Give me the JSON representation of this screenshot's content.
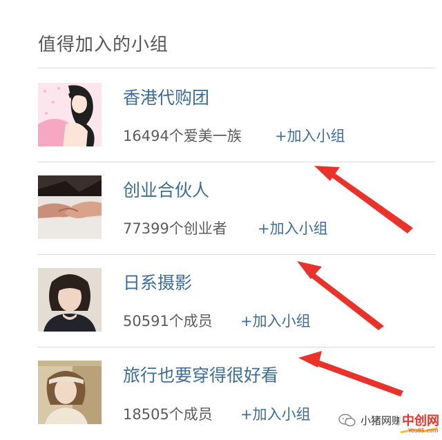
{
  "section": {
    "title": "值得加入的小组"
  },
  "groups": [
    {
      "name": "香港代购团",
      "count": "16494个爱美一族",
      "join": "+加入小组",
      "thumb": "woman-illustration-thumbnail"
    },
    {
      "name": "创业合伙人",
      "count": "77399个创业者",
      "join": "+加入小组",
      "thumb": "handshake-thumbnail"
    },
    {
      "name": "日系摄影",
      "count": "50591个成员",
      "join": "+加入小组",
      "thumb": "portrait-thumbnail"
    },
    {
      "name": "旅行也要穿得很好看",
      "count": "18505个成员",
      "join": "+加入小组",
      "thumb": "traveler-thumbnail"
    }
  ],
  "watermark": {
    "text": "小猪网赚",
    "brand": "中创网",
    "site": "You85.com"
  },
  "colors": {
    "link": "#3d6c96",
    "arrow": "#e8322a",
    "divider": "#d9d9d9"
  }
}
